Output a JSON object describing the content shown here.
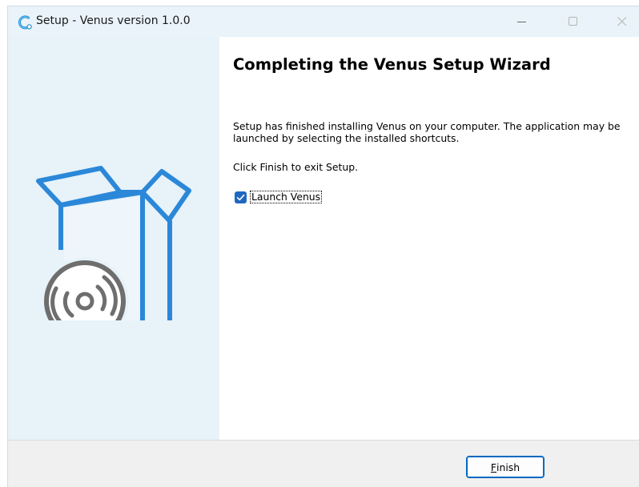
{
  "window": {
    "title": "Setup - Venus version 1.0.0"
  },
  "content": {
    "heading": "Completing the Venus Setup Wizard",
    "body": "Setup has finished installing Venus on your computer. The application may be launched by selecting the installed shortcuts.",
    "finish_note": "Click Finish to exit Setup."
  },
  "launch": {
    "label": "Launch Venus",
    "checked": true
  },
  "footer": {
    "finish_first": "F",
    "finish_rest": "inish"
  },
  "icons": {
    "app": "setup-app-icon",
    "minimize": "minimize-icon",
    "maximize": "maximize-icon",
    "close": "close-icon",
    "art": "box-with-disc-illustration"
  },
  "colors": {
    "titlebar": "#e9f3f9",
    "sidebar": "#e7f2f9",
    "accent": "#1f67bf",
    "box_blue": "#2b88d8",
    "disc_gray": "#6e6e6e"
  }
}
